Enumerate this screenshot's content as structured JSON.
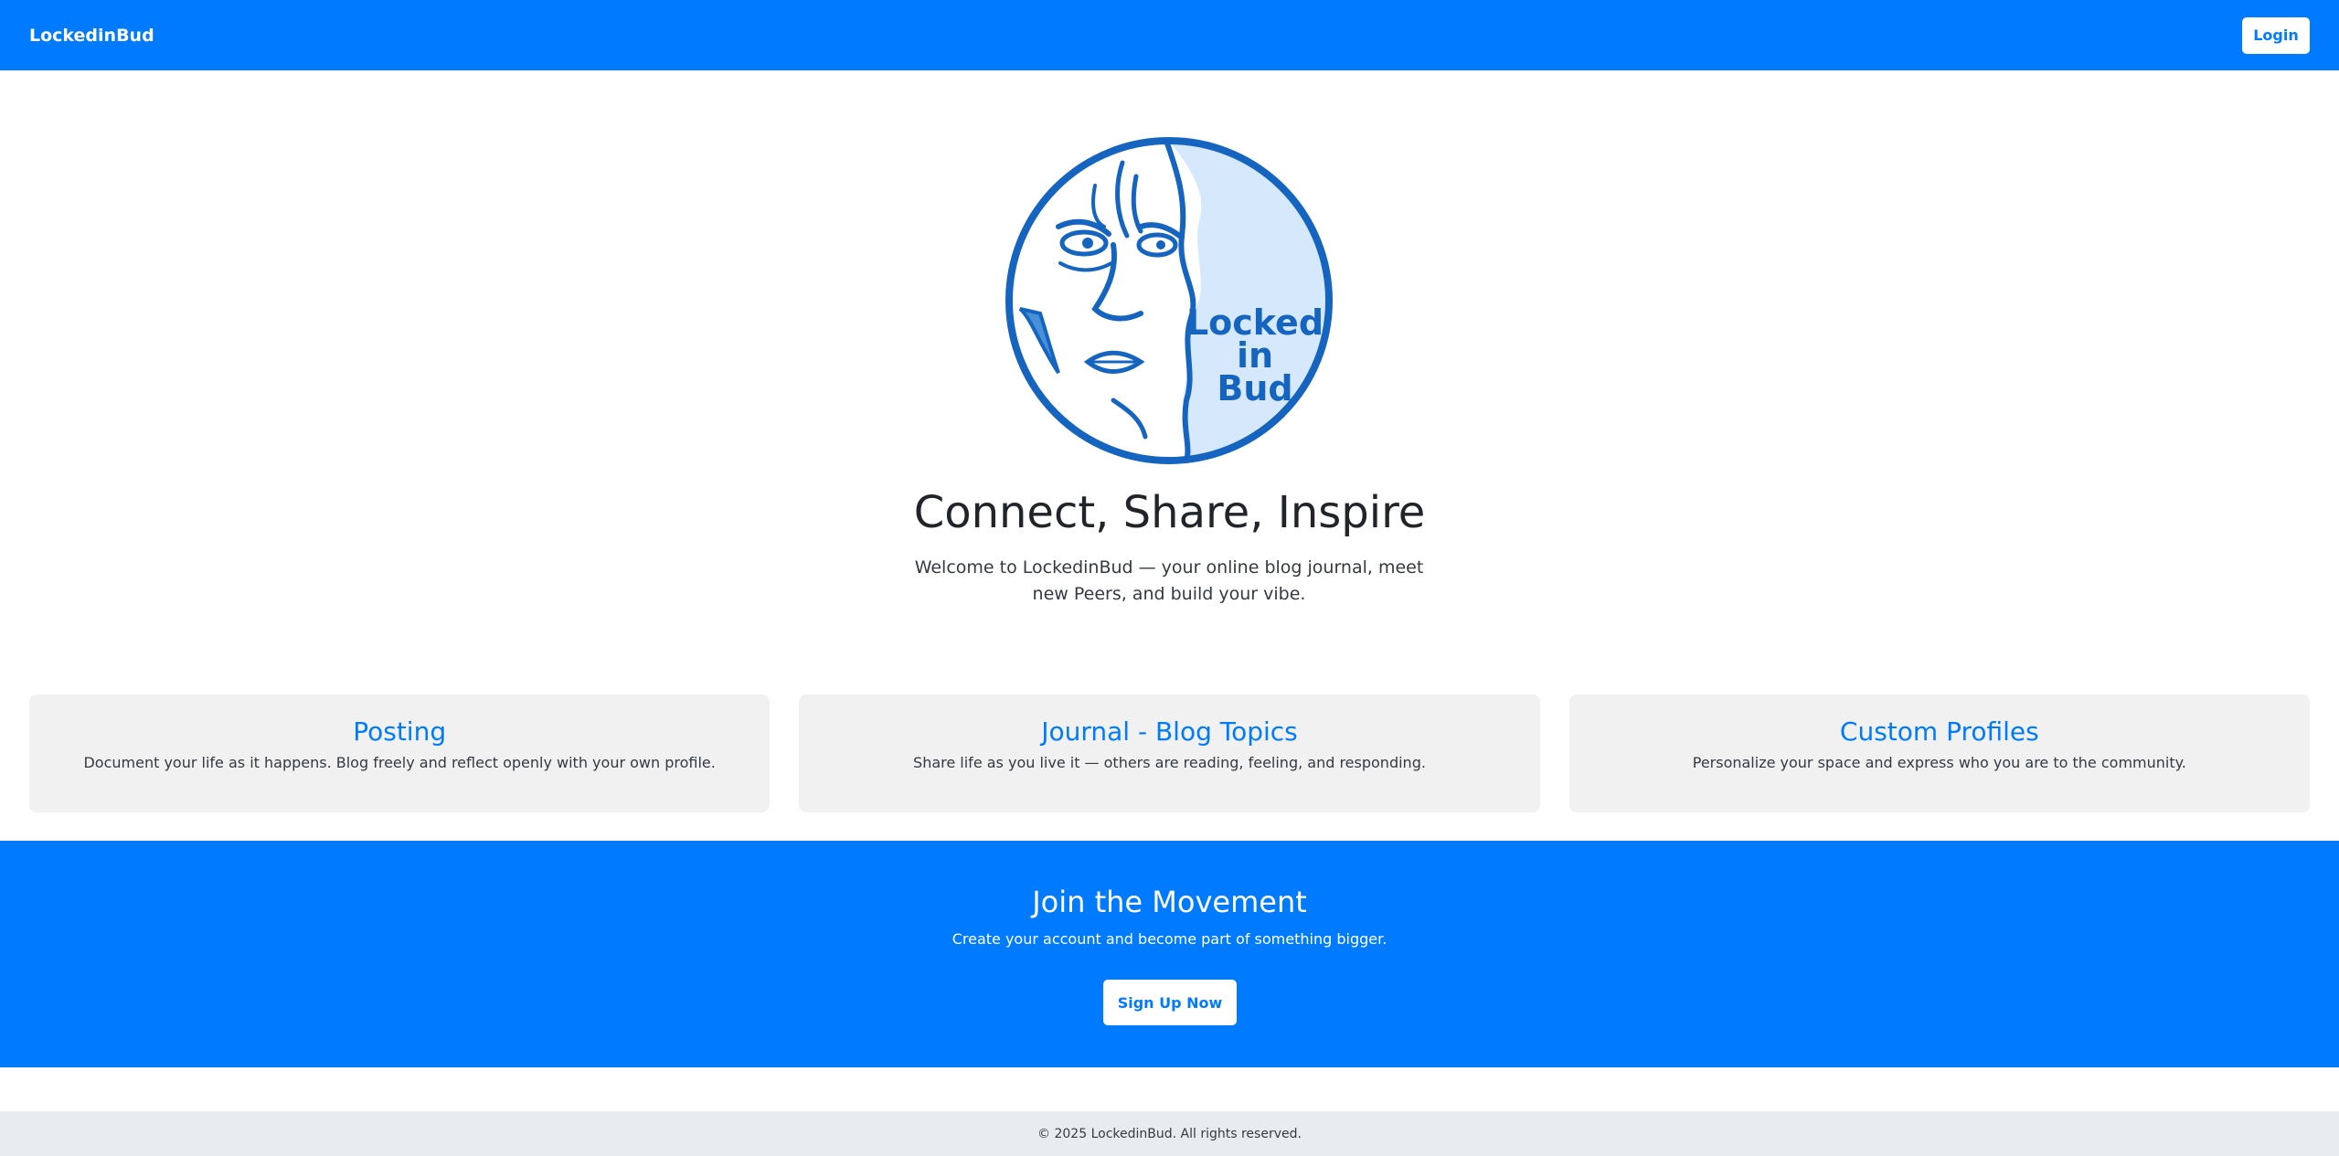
{
  "navbar": {
    "brand": "LockedinBud",
    "login_label": "Login"
  },
  "hero": {
    "logo_text_line1": "Locked",
    "logo_text_line2": "in",
    "logo_text_line3": "Bud",
    "title": "Connect, Share, Inspire",
    "subtitle": "Welcome to LockedinBud — your online blog journal, meet new Peers, and build your vibe."
  },
  "features": [
    {
      "title": "Posting",
      "description": "Document your life as it happens. Blog freely and reflect openly with your own profile."
    },
    {
      "title": "Journal - Blog Topics",
      "description": "Share life as you live it — others are reading, feeling, and responding."
    },
    {
      "title": "Custom Profiles",
      "description": "Personalize your space and express who you are to the community."
    }
  ],
  "cta": {
    "title": "Join the Movement",
    "subtitle": "Create your account and become part of something bigger.",
    "signup_label": "Sign Up Now"
  },
  "footer": {
    "text": "© 2025 LockedinBud. All rights reserved."
  },
  "colors": {
    "primary": "#007bff",
    "card_bg": "#f1f1f1",
    "footer_bg": "#e9ecef",
    "logo_blue": "#1565c0",
    "logo_light": "#d6e8fb"
  }
}
